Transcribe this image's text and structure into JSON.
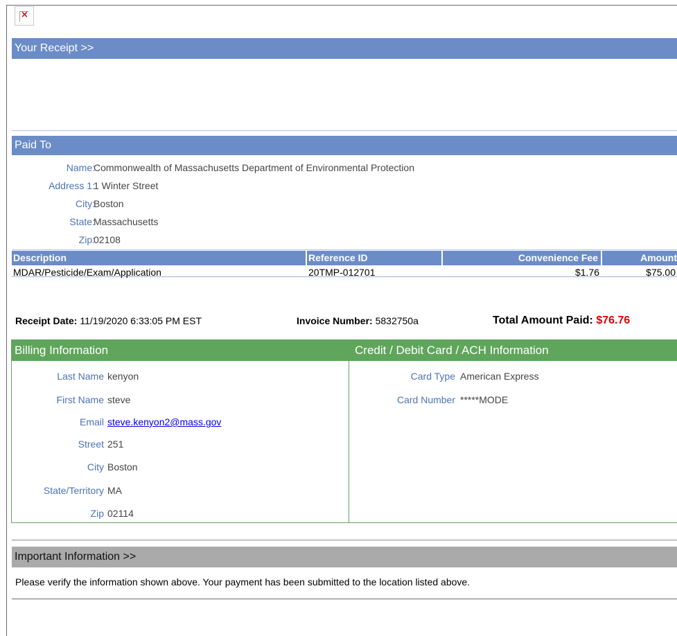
{
  "header": {
    "receipt_title": "Your Receipt >>"
  },
  "paid_to": {
    "title": "Paid To",
    "rows": [
      {
        "label": "Name:",
        "value": "Commonwealth of Massachusetts Department of Environmental Protection"
      },
      {
        "label": "Address 1:",
        "value": "1 Winter Street"
      },
      {
        "label": "City:",
        "value": "Boston"
      },
      {
        "label": "State:",
        "value": "Massachusetts"
      },
      {
        "label": "Zip:",
        "value": "02108"
      }
    ]
  },
  "items_table": {
    "headers": {
      "description": "Description",
      "reference_id": "Reference ID",
      "convenience_fee": "Convenience Fee",
      "amount": "Amount"
    },
    "rows": [
      {
        "description": "MDAR/Pesticide/Exam/Application",
        "reference_id": "20TMP-012701",
        "convenience_fee": "$1.76",
        "amount": "$75.00"
      }
    ]
  },
  "summary": {
    "receipt_date_label": "Receipt Date:",
    "receipt_date": "11/19/2020 6:33:05 PM EST",
    "invoice_label": "Invoice Number:",
    "invoice_number": "5832750a",
    "total_label": "Total Amount Paid:",
    "total_amount": "$76.76"
  },
  "billing": {
    "title": "Billing Information",
    "rows": [
      {
        "label": "Last Name",
        "value": "kenyon"
      },
      {
        "label": "First Name",
        "value": "steve"
      },
      {
        "label": "Email",
        "value": "steve.kenyon2@mass.gov"
      },
      {
        "label": "Street",
        "value": "251"
      },
      {
        "label": "City",
        "value": "Boston"
      },
      {
        "label": "State/Territory",
        "value": "MA"
      },
      {
        "label": "Zip",
        "value": "02114"
      }
    ]
  },
  "card": {
    "title": "Credit / Debit Card / ACH Information",
    "rows": [
      {
        "label": "Card Type",
        "value": "American Express"
      },
      {
        "label": "Card Number",
        "value": "*****MODE"
      }
    ]
  },
  "important": {
    "title": "Important Information >>",
    "text": "Please verify the information shown above. Your payment has been submitted to the location listed above."
  },
  "colors": {
    "blue_bar": "#6b8cc7",
    "green_bar": "#5fa55b",
    "gray_bar": "#aaaaaa",
    "total_red": "#e00000",
    "label_blue": "#4c73b4"
  },
  "icons": {
    "broken_image": "broken-image-icon"
  }
}
